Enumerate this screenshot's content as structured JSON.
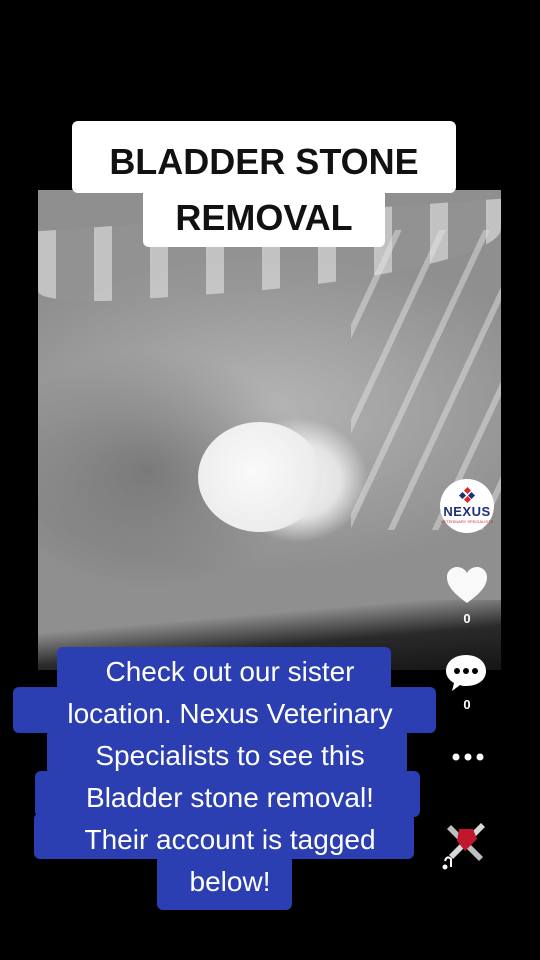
{
  "title": {
    "line1": "BLADDER STONE",
    "line2": "REMOVAL",
    "full": "BLADDER STONE\nREMOVAL"
  },
  "caption": {
    "lines": [
      "Check out our sister",
      "location. Nexus Veterinary",
      "Specialists to see this",
      "Bladder stone removal!",
      "Their account is tagged",
      "below!"
    ],
    "full": "Check out our sister\nlocation. Nexus Veterinary\nSpecialists to see this\nBladder stone removal!\nTheir account is tagged\nbelow!"
  },
  "profile": {
    "name": "NEXUS",
    "tagline": "VETERINARY SPECIALISTS"
  },
  "actions": {
    "likes": "0",
    "comments": "0"
  },
  "colors": {
    "caption_bg": "#2b3eb2",
    "title_bg": "#ffffff",
    "brand_red": "#d62b2b",
    "brand_navy": "#1e2f7a"
  },
  "icons": [
    "heart-icon",
    "comment-icon",
    "more-icon",
    "music-disc-icon"
  ]
}
